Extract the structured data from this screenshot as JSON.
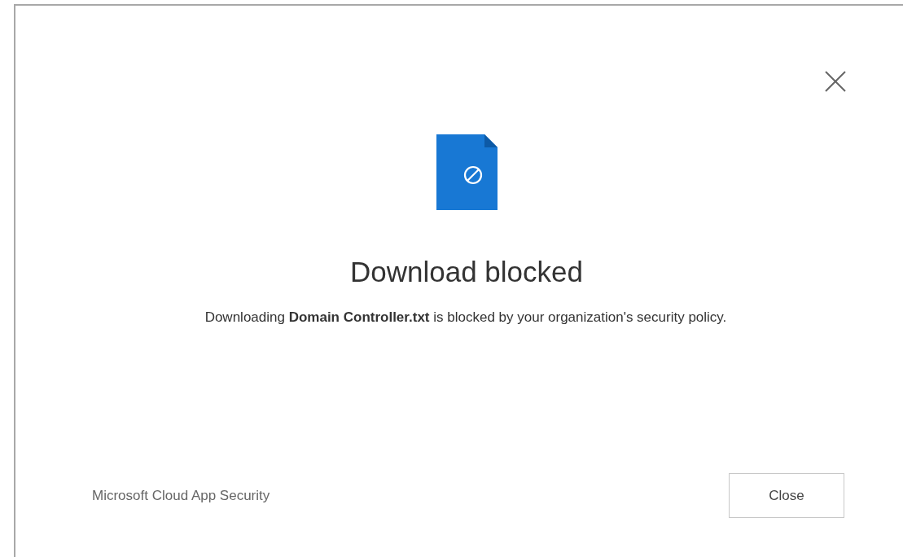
{
  "dialog": {
    "title": "Download blocked",
    "message": "Downloading **Domain Controller.txt** is blocked by your organization's security policy.",
    "footer": "Microsoft Cloud App Security",
    "buttons": [
      {
        "label": "Close"
      }
    ]
  }
}
